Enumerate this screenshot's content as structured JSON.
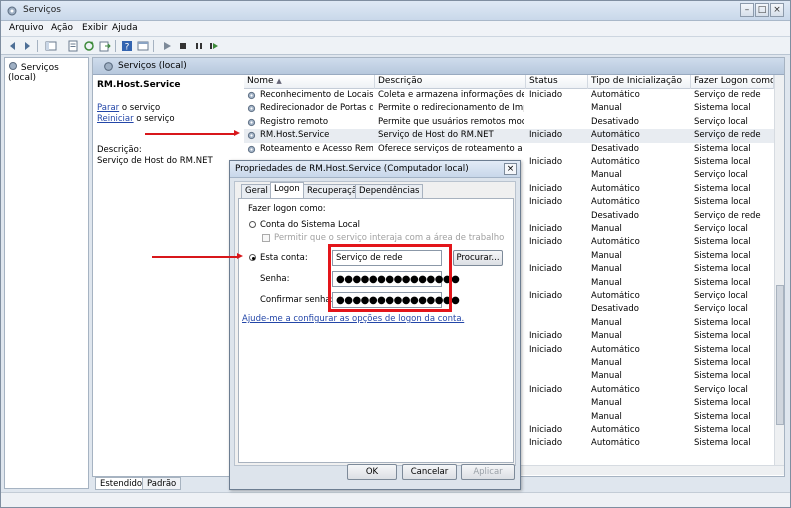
{
  "window": {
    "title": "Serviços"
  },
  "menu": [
    "Arquivo",
    "Ação",
    "Exibir",
    "Ajuda"
  ],
  "tree": {
    "node": "Serviços (local)"
  },
  "pane": {
    "header": "Serviços (local)"
  },
  "details": {
    "service_name": "RM.Host.Service",
    "stop_link": "Parar",
    "stop_suffix": " o serviço",
    "restart_link": "Reiniciar",
    "restart_suffix": " o serviço",
    "description_label": "Descrição:",
    "description_text": "Serviço de Host do RM.NET"
  },
  "grid": {
    "columns": [
      "Nome",
      "Descrição",
      "Status",
      "Tipo de Inicialização",
      "Fazer Logon como"
    ],
    "rows": [
      {
        "name": "Reconhecimento de Locais d...",
        "desc": "Coleta e armazena informações de c...",
        "status": "Iniciado",
        "startup": "Automático",
        "logon": "Serviço de rede"
      },
      {
        "name": "Redirecionador de Portas do ...",
        "desc": "Permite o redirecionamento de Impr...",
        "status": "",
        "startup": "Manual",
        "logon": "Sistema local"
      },
      {
        "name": "Registro remoto",
        "desc": "Permite que usuários remotos modif...",
        "status": "",
        "startup": "Desativado",
        "logon": "Serviço local"
      },
      {
        "name": "RM.Host.Service",
        "desc": "Serviço de Host do RM.NET",
        "status": "Iniciado",
        "startup": "Automático",
        "logon": "Serviço de rede"
      },
      {
        "name": "Roteamento e Acesso Remoto",
        "desc": "Oferece serviços de roteamento a e...",
        "status": "",
        "startup": "Desativado",
        "logon": "Sistema local"
      },
      {
        "name": "",
        "desc": "",
        "status": "Iniciado",
        "startup": "Automático",
        "logon": "Sistema local"
      },
      {
        "name": "",
        "desc": "",
        "status": "",
        "startup": "Manual",
        "logon": "Serviço local"
      },
      {
        "name": "",
        "desc": "",
        "status": "Iniciado",
        "startup": "Automático",
        "logon": "Sistema local"
      },
      {
        "name": "",
        "desc": "",
        "status": "Iniciado",
        "startup": "Automático",
        "logon": "Sistema local"
      },
      {
        "name": "",
        "desc": "",
        "status": "",
        "startup": "Desativado",
        "logon": "Serviço de rede"
      },
      {
        "name": "",
        "desc": "",
        "status": "Iniciado",
        "startup": "Manual",
        "logon": "Serviço local"
      },
      {
        "name": "",
        "desc": "",
        "status": "Iniciado",
        "startup": "Automático",
        "logon": "Sistema local"
      },
      {
        "name": "",
        "desc": "",
        "status": "",
        "startup": "Manual",
        "logon": "Sistema local"
      },
      {
        "name": "",
        "desc": "",
        "status": "Iniciado",
        "startup": "Manual",
        "logon": "Sistema local"
      },
      {
        "name": "",
        "desc": "",
        "status": "",
        "startup": "Manual",
        "logon": "Sistema local"
      },
      {
        "name": "",
        "desc": "",
        "status": "Iniciado",
        "startup": "Automático",
        "logon": "Serviço local"
      },
      {
        "name": "",
        "desc": "",
        "status": "",
        "startup": "Desativado",
        "logon": "Serviço local"
      },
      {
        "name": "",
        "desc": "",
        "status": "",
        "startup": "Manual",
        "logon": "Sistema local"
      },
      {
        "name": "",
        "desc": "",
        "status": "Iniciado",
        "startup": "Manual",
        "logon": "Sistema local"
      },
      {
        "name": "",
        "desc": "",
        "status": "Iniciado",
        "startup": "Automático",
        "logon": "Sistema local"
      },
      {
        "name": "",
        "desc": "",
        "status": "",
        "startup": "Manual",
        "logon": "Sistema local"
      },
      {
        "name": "",
        "desc": "",
        "status": "",
        "startup": "Manual",
        "logon": "Sistema local"
      },
      {
        "name": "",
        "desc": "",
        "status": "Iniciado",
        "startup": "Automático",
        "logon": "Serviço local"
      },
      {
        "name": "",
        "desc": "",
        "status": "",
        "startup": "Manual",
        "logon": "Sistema local"
      },
      {
        "name": "",
        "desc": "",
        "status": "",
        "startup": "Manual",
        "logon": "Sistema local"
      },
      {
        "name": "",
        "desc": "",
        "status": "Iniciado",
        "startup": "Automático",
        "logon": "Sistema local"
      },
      {
        "name": "",
        "desc": "",
        "status": "Iniciado",
        "startup": "Automático",
        "logon": "Sistema local"
      }
    ]
  },
  "bottom_tabs": [
    "Estendido",
    "Padrão"
  ],
  "dialog": {
    "title": "Propriedades de RM.Host.Service (Computador local)",
    "close": "×",
    "tabs": [
      "Geral",
      "Logon",
      "Recuperação",
      "Dependências"
    ],
    "logon_as_label": "Fazer logon como:",
    "local_system": "Conta do Sistema Local",
    "interact_desktop": "Permitir que o serviço interaja com a área de trabalho",
    "this_account": "Esta conta:",
    "account_value": "Serviço de rede",
    "browse": "Procurar...",
    "password_label": "Senha:",
    "password_value": "●●●●●●●●●●●●●●●",
    "confirm_label": "Confirmar senha:",
    "confirm_value": "●●●●●●●●●●●●●●●",
    "help_link": "Ajude-me a configurar as opções de logon da conta.",
    "ok": "OK",
    "cancel": "Cancelar",
    "apply": "Aplicar"
  },
  "icons": [
    "back-icon",
    "forward-icon",
    "console-tree-icon",
    "properties-icon",
    "refresh-icon",
    "export-icon",
    "help-icon",
    "console-icon",
    "play-icon",
    "stop-icon",
    "pause-icon",
    "restart-icon",
    "gear-icon"
  ],
  "colors": {
    "annotation": "#e3151a",
    "link": "#2346a8"
  }
}
